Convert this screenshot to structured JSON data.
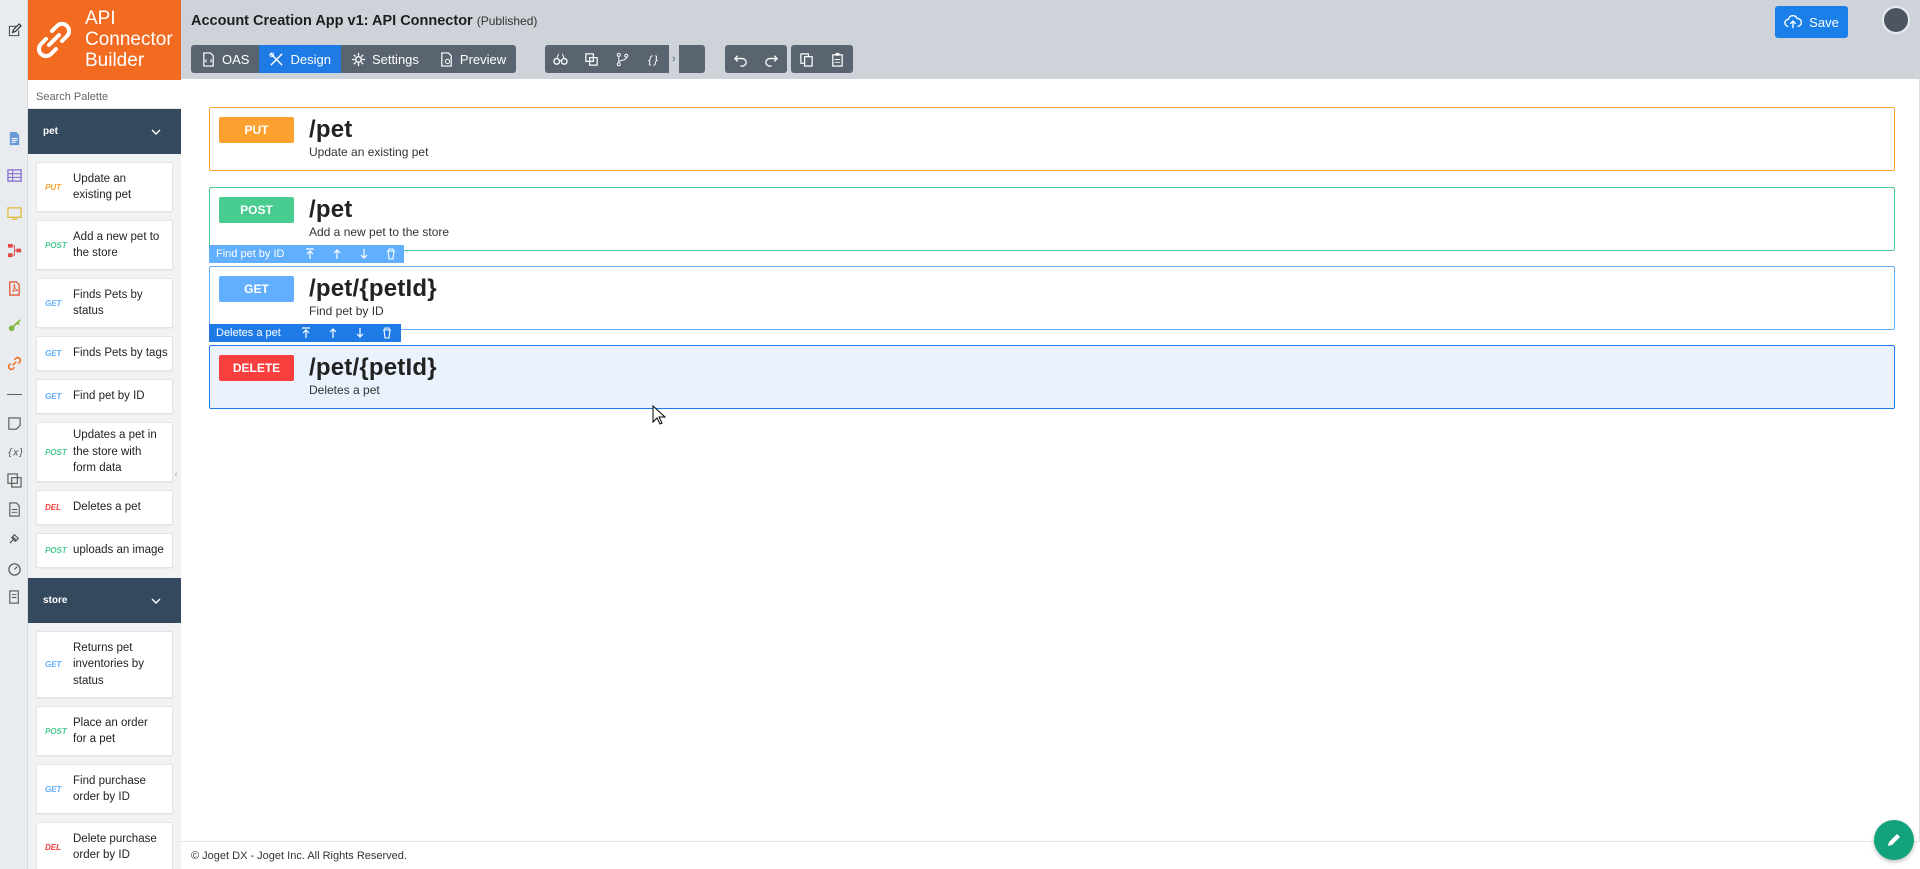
{
  "app": {
    "title": "Account Creation App v1: API Connector",
    "status": "(Published)",
    "builder_name": "API Connector Builder",
    "save_label": "Save"
  },
  "palette": {
    "search_placeholder": "Search Palette",
    "groups": [
      {
        "name": "pet",
        "items": [
          {
            "method": "PUT",
            "label": "Update an existing pet"
          },
          {
            "method": "POST",
            "label": "Add a new pet to the store"
          },
          {
            "method": "GET",
            "label": "Finds Pets by status"
          },
          {
            "method": "GET",
            "label": "Finds Pets by tags"
          },
          {
            "method": "GET",
            "label": "Find pet by ID"
          },
          {
            "method": "POST",
            "label": "Updates a pet in the store with form data"
          },
          {
            "method": "DEL",
            "label": "Deletes a pet"
          },
          {
            "method": "POST",
            "label": "uploads an image"
          }
        ]
      },
      {
        "name": "store",
        "items": [
          {
            "method": "GET",
            "label": "Returns pet inventories by status"
          },
          {
            "method": "POST",
            "label": "Place an order for a pet"
          },
          {
            "method": "GET",
            "label": "Find purchase order by ID"
          },
          {
            "method": "DEL",
            "label": "Delete purchase order by ID"
          }
        ]
      }
    ]
  },
  "toolbar": {
    "tabs": [
      "OAS",
      "Design",
      "Settings",
      "Preview"
    ],
    "active_tab": "Design",
    "tool_icons": [
      "binoculars-icon",
      "copy-layout-icon",
      "branch-icon",
      "braces-icon"
    ],
    "history_icons": [
      "undo-icon",
      "redo-icon"
    ],
    "clipboard_icons": [
      "copy-icon",
      "paste-icon"
    ]
  },
  "operations": [
    {
      "method": "PUT",
      "path": "/pet",
      "summary": "Update an existing pet"
    },
    {
      "method": "POST",
      "path": "/pet",
      "summary": "Add a new pet to the store"
    },
    {
      "method": "GET",
      "path": "/pet/{petId}",
      "summary": "Find pet by ID",
      "tag_label": "Find pet by ID"
    },
    {
      "method": "DELETE",
      "path": "/pet/{petId}",
      "summary": "Deletes a pet",
      "tag_label": "Deletes a pet"
    }
  ],
  "footer": {
    "copyright": "© Joget DX - Joget Inc. All Rights Reserved."
  },
  "colors": {
    "brand": "#f36b21",
    "put": "#fca130",
    "post": "#49cc90",
    "get": "#61affe",
    "delete": "#f93e3e",
    "accent": "#1e7be6",
    "palette_header": "#34495e",
    "topbar": "#ced3d9"
  }
}
